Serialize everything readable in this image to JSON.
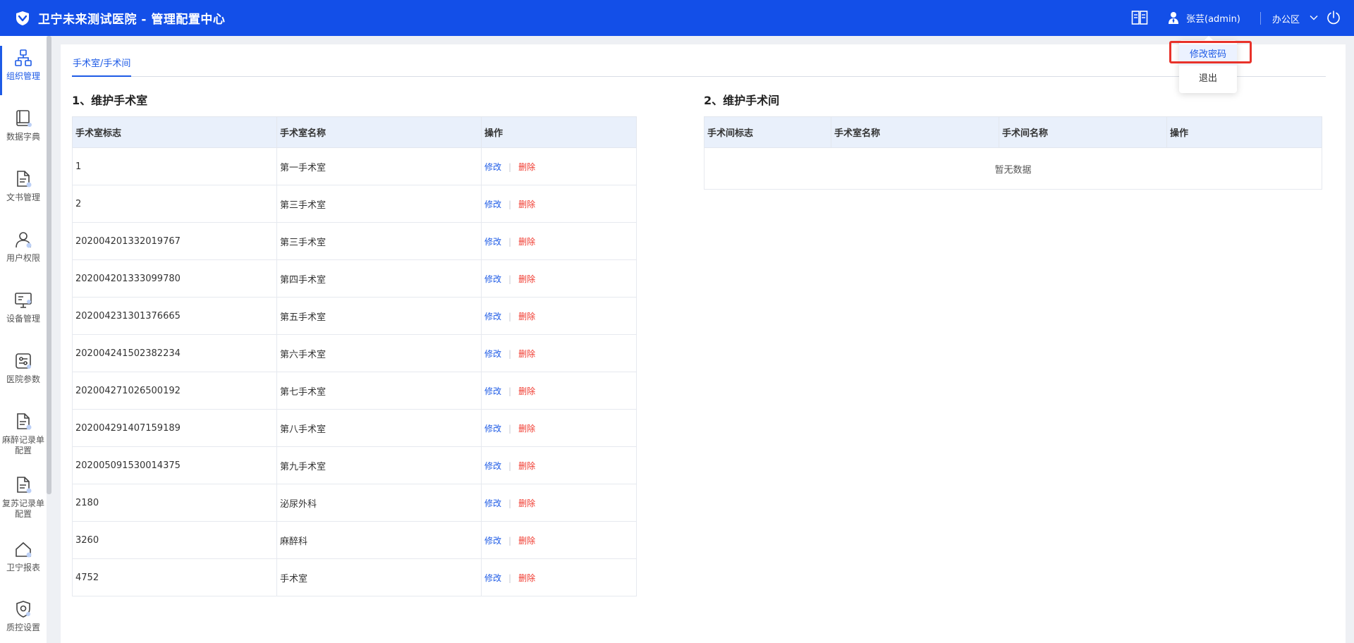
{
  "header": {
    "app_title": "卫宁未来测试医院 - 管理配置中心",
    "user_name": "张芸(admin)",
    "office": "办公区"
  },
  "user_menu": {
    "items": [
      {
        "label": "修改密码"
      },
      {
        "label": "退出"
      }
    ]
  },
  "sidebar": {
    "items": [
      {
        "label": "组织管理",
        "icon": "org-chart-icon"
      },
      {
        "label": "数据字典",
        "icon": "book-icon"
      },
      {
        "label": "文书管理",
        "icon": "document-icon"
      },
      {
        "label": "用户权限",
        "icon": "user-icon"
      },
      {
        "label": "设备管理",
        "icon": "monitor-icon"
      },
      {
        "label": "医院参数",
        "icon": "settings-panel-icon"
      },
      {
        "label": "麻醉记录单配置",
        "icon": "document-icon"
      },
      {
        "label": "复苏记录单配置",
        "icon": "document-icon"
      },
      {
        "label": "卫宁报表",
        "icon": "home-icon"
      },
      {
        "label": "质控设置",
        "icon": "shield-icon"
      }
    ]
  },
  "tabs": [
    {
      "label": "手术室/手术间"
    }
  ],
  "section1": {
    "title": "1、维护手术室",
    "columns": [
      "手术室标志",
      "手术室名称",
      "操作"
    ],
    "edit_label": "修改",
    "delete_label": "删除",
    "rows": [
      {
        "id": "1",
        "name": "第一手术室"
      },
      {
        "id": "2",
        "name": "第三手术室"
      },
      {
        "id": "202004201332019767",
        "name": "第三手术室"
      },
      {
        "id": "202004201333099780",
        "name": "第四手术室"
      },
      {
        "id": "202004231301376665",
        "name": "第五手术室"
      },
      {
        "id": "202004241502382234",
        "name": "第六手术室"
      },
      {
        "id": "202004271026500192",
        "name": "第七手术室"
      },
      {
        "id": "202004291407159189",
        "name": "第八手术室"
      },
      {
        "id": "202005091530014375",
        "name": "第九手术室"
      },
      {
        "id": "2180",
        "name": "泌尿外科"
      },
      {
        "id": "3260",
        "name": "麻醉科"
      },
      {
        "id": "4752",
        "name": "手术室"
      }
    ]
  },
  "section2": {
    "title": "2、维护手术间",
    "columns": [
      "手术间标志",
      "手术室名称",
      "手术间名称",
      "操作"
    ],
    "empty_text": "暂无数据"
  },
  "colors": {
    "header_bg": "#134fe8",
    "accent": "#1e5be6",
    "danger": "#f03a2f",
    "table_header_bg": "#e9f0fb",
    "highlight_border": "#e8322a"
  }
}
